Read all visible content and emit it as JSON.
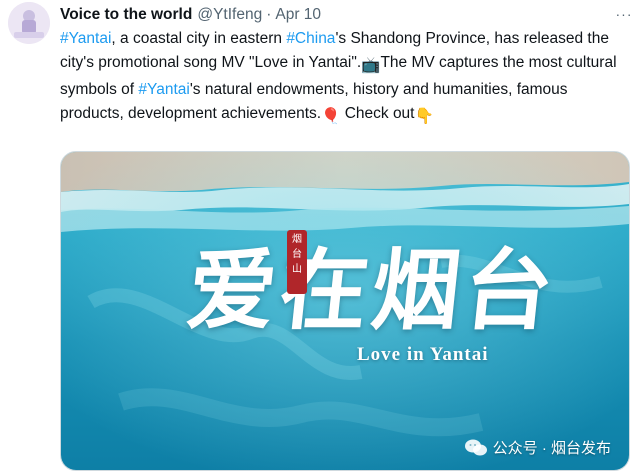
{
  "author": {
    "name": "Voice to the world",
    "handle": "@YtIfeng",
    "separator": "·",
    "date": "Apr 10"
  },
  "more_label": "···",
  "tweet": {
    "segments": [
      {
        "type": "hashtag",
        "text": "#Yantai"
      },
      {
        "type": "text",
        "text": ", a coastal city in eastern "
      },
      {
        "type": "hashtag",
        "text": "#China"
      },
      {
        "type": "text",
        "text": "'s Shandong Province, has released the city's promotional song MV \"Love in Yantai\"."
      },
      {
        "type": "emoji",
        "text": "📺"
      },
      {
        "type": "text",
        "text": "The MV captures the most cultural symbols of "
      },
      {
        "type": "hashtag",
        "text": "#Yantai"
      },
      {
        "type": "text",
        "text": "'s natural endowments, history and humanities, famous products, development achievements."
      },
      {
        "type": "emoji",
        "text": "🎈"
      },
      {
        "type": "text",
        "text": " Check out"
      },
      {
        "type": "emoji",
        "text": "👇"
      }
    ]
  },
  "media": {
    "title_cn": "爱在烟台",
    "title_en": "Love in Yantai",
    "seal_text": "烟台山",
    "watermark": "公众号 · 烟台发布"
  },
  "colors": {
    "hashtag": "#1d9bf0",
    "text": "#0f1419",
    "muted": "#536471",
    "sea_deep": "#0f8fb3",
    "sea_light": "#5fd3e3",
    "sand": "#d9cdbb"
  }
}
